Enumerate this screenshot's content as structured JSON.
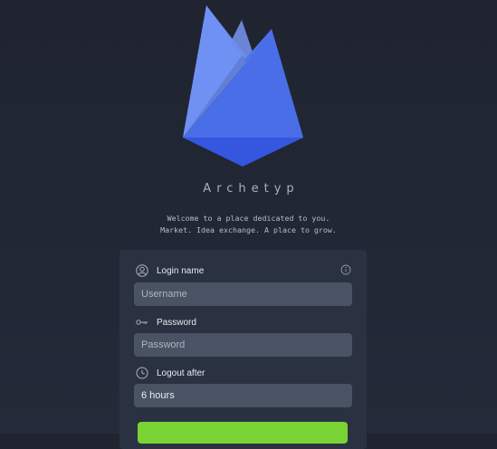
{
  "brand": {
    "name": "Archetyp",
    "tagline_line1": "Welcome to a place dedicated to you.",
    "tagline_line2": "Market. Idea exchange. A place to grow."
  },
  "login_form": {
    "login_name": {
      "label": "Login name",
      "placeholder": "Username",
      "icon": "user-icon"
    },
    "password": {
      "label": "Password",
      "placeholder": "Password",
      "icon": "key-icon"
    },
    "logout_after": {
      "label": "Logout after",
      "value": "6 hours",
      "icon": "clock-icon"
    },
    "info_icon": "info-icon",
    "submit_label": ""
  },
  "colors": {
    "background": "#1f2430",
    "card": "#2a3242",
    "input": "#4a5363",
    "accent_green": "#7ad335",
    "logo_blue": "#3d63e0"
  }
}
